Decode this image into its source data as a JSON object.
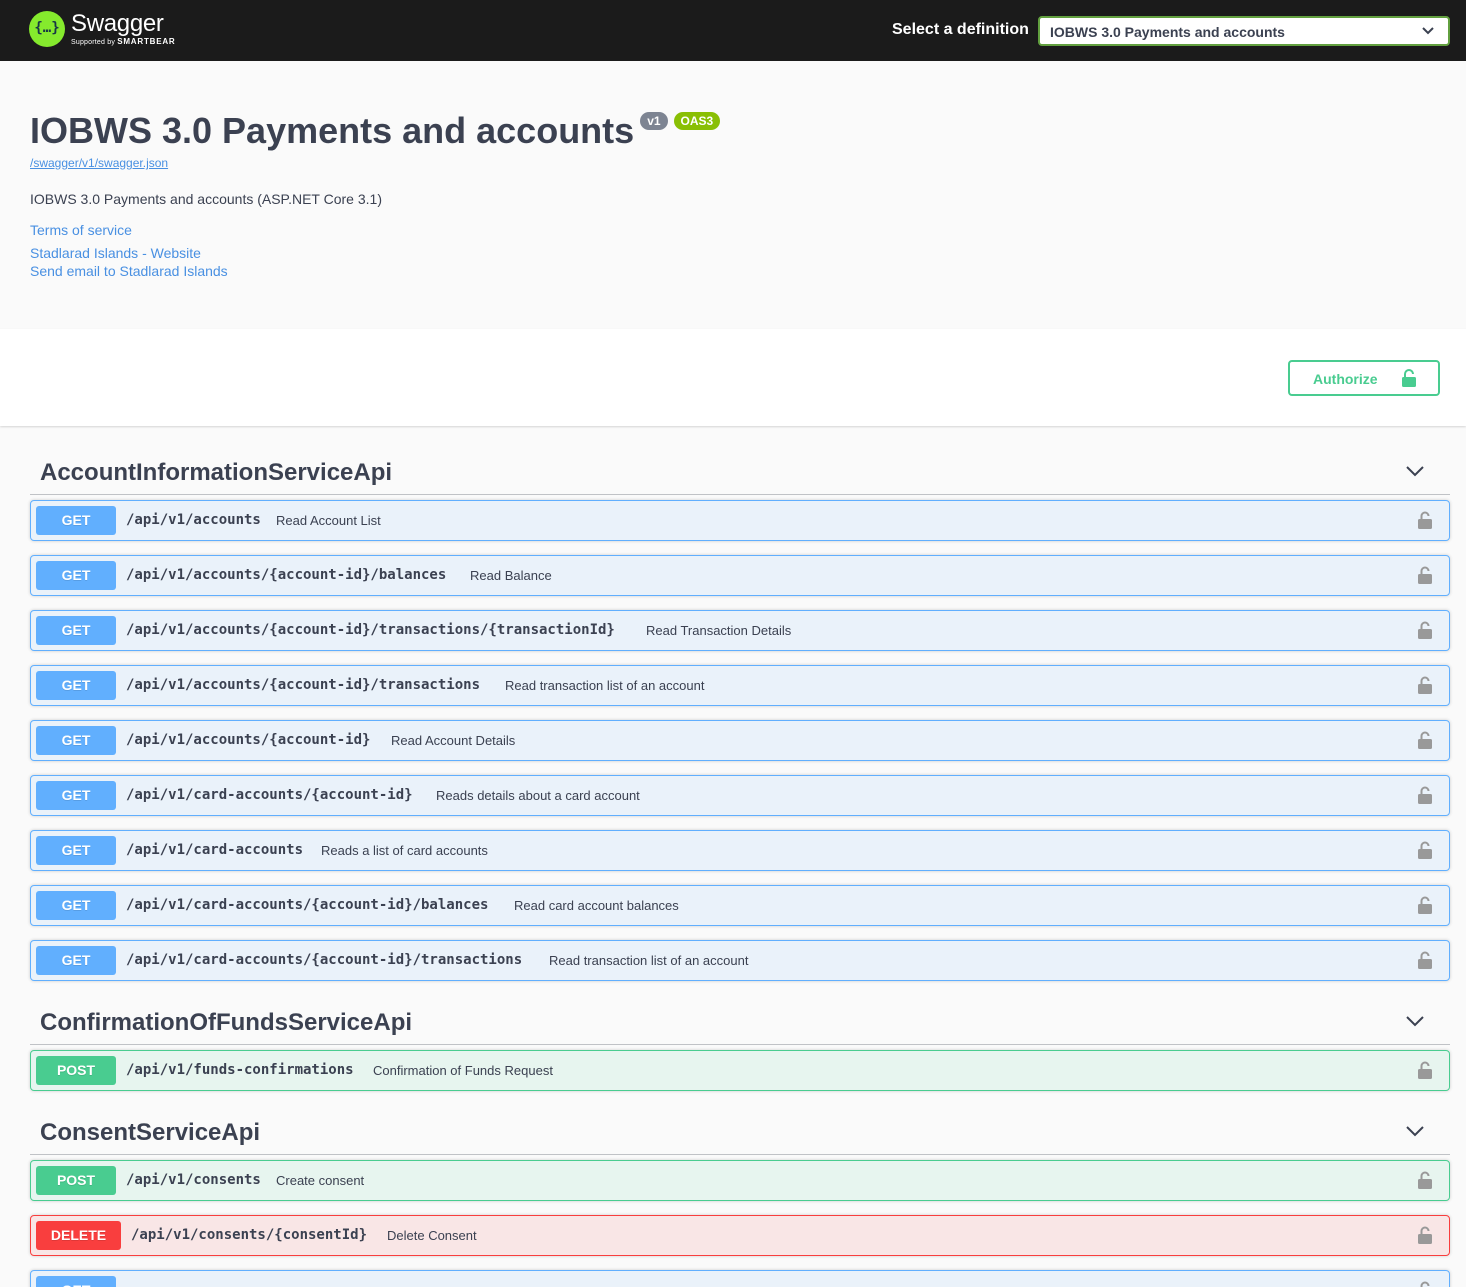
{
  "topbar": {
    "brand": "Swagger",
    "brand_sub": "Supported by",
    "brand_sub_strong": "SMARTBEAR",
    "select_label": "Select a definition",
    "select_value": "IOBWS 3.0 Payments and accounts"
  },
  "info": {
    "title": "IOBWS 3.0 Payments and accounts",
    "version_badge": "v1",
    "oas_badge": "OAS3",
    "json_link": "/swagger/v1/swagger.json",
    "description": "IOBWS 3.0 Payments and accounts (ASP.NET Core 3.1)",
    "terms_link": "Terms of service",
    "website_link": "Stadlarad Islands - Website",
    "email_link": "Send email to Stadlarad Islands"
  },
  "authorize": {
    "label": "Authorize"
  },
  "tags": [
    {
      "name": "AccountInformationServiceApi",
      "operations": [
        {
          "method": "GET",
          "path": "/api/v1/accounts",
          "summary": "Read Account List"
        },
        {
          "method": "GET",
          "path": "/api/v1/accounts/{account-id}/balances",
          "summary": "Read Balance"
        },
        {
          "method": "GET",
          "path": "/api/v1/accounts/{account-id}/transactions/{transactionId}",
          "summary": "Read Transaction Details"
        },
        {
          "method": "GET",
          "path": "/api/v1/accounts/{account-id}/transactions",
          "summary": "Read transaction list of an account"
        },
        {
          "method": "GET",
          "path": "/api/v1/accounts/{account-id}",
          "summary": "Read Account Details"
        },
        {
          "method": "GET",
          "path": "/api/v1/card-accounts/{account-id}",
          "summary": "Reads details about a card account"
        },
        {
          "method": "GET",
          "path": "/api/v1/card-accounts",
          "summary": "Reads a list of card accounts"
        },
        {
          "method": "GET",
          "path": "/api/v1/card-accounts/{account-id}/balances",
          "summary": "Read card account balances"
        },
        {
          "method": "GET",
          "path": "/api/v1/card-accounts/{account-id}/transactions",
          "summary": "Read transaction list of an account"
        }
      ]
    },
    {
      "name": "ConfirmationOfFundsServiceApi",
      "operations": [
        {
          "method": "POST",
          "path": "/api/v1/funds-confirmations",
          "summary": "Confirmation of Funds Request"
        }
      ]
    },
    {
      "name": "ConsentServiceApi",
      "operations": [
        {
          "method": "POST",
          "path": "/api/v1/consents",
          "summary": "Create consent"
        },
        {
          "method": "DELETE",
          "path": "/api/v1/consents/{consentId}",
          "summary": "Delete Consent"
        },
        {
          "method": "GET",
          "path": "",
          "summary": ""
        }
      ]
    }
  ],
  "colors": {
    "topbar_bg": "#1b1b1b",
    "get": "#61affe",
    "post": "#49cc90",
    "delete": "#f93e3e",
    "link": "#4990e2",
    "brand_green": "#85ea2d",
    "oas_badge": "#89bf04"
  },
  "icons": {
    "logo": "swagger-logo-icon",
    "select_chevron": "chevron-down-icon",
    "authorize_lock": "unlocked-padlock-icon",
    "tag_chevron": "chevron-down-icon",
    "op_lock": "unlocked-padlock-icon"
  }
}
